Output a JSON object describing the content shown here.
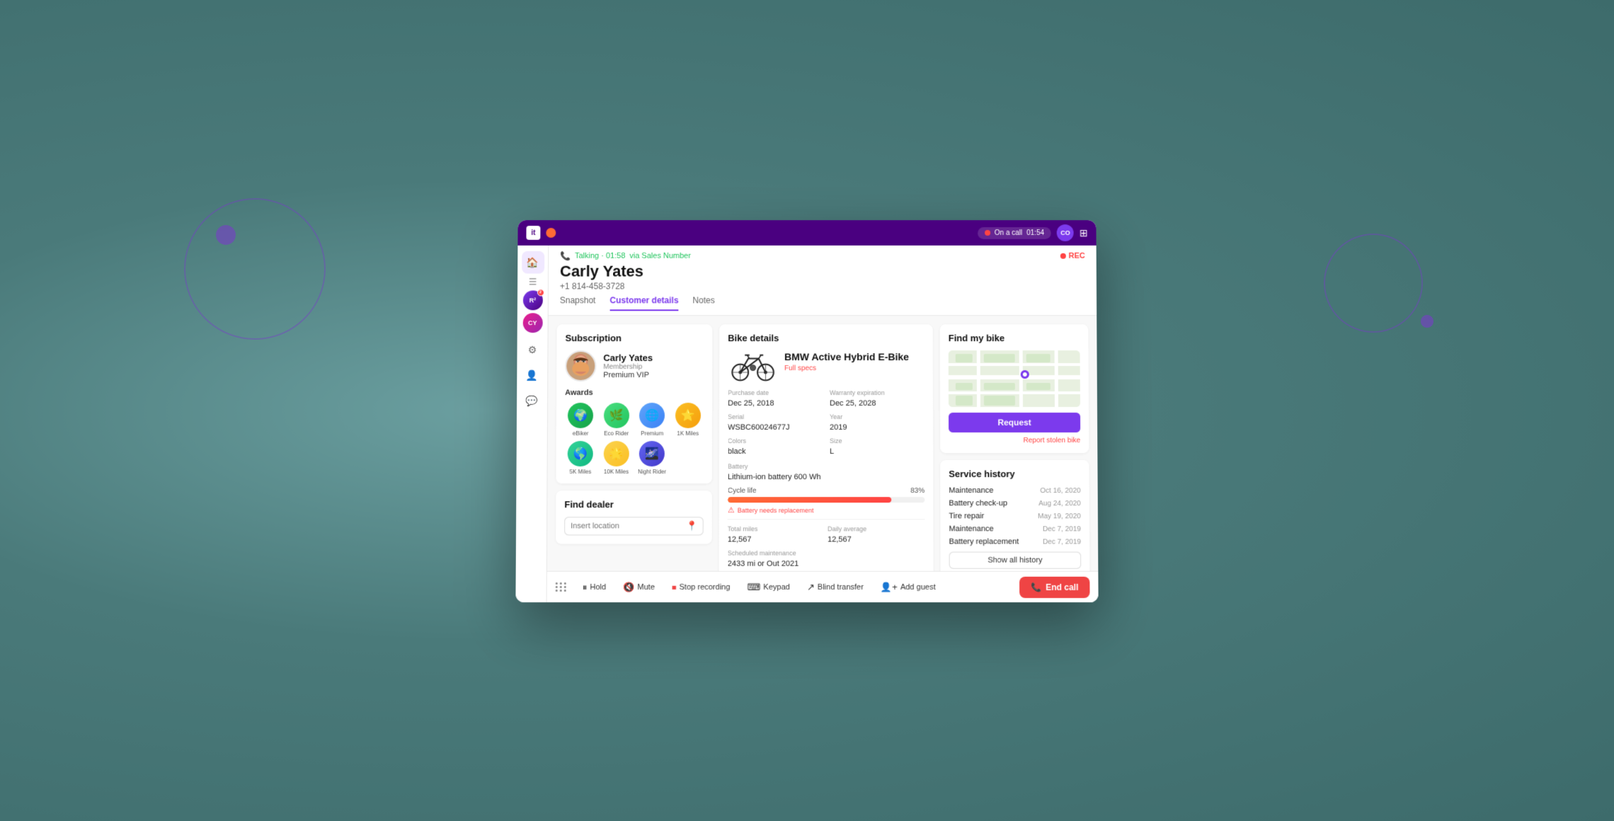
{
  "titleBar": {
    "logoText": "it",
    "callBadge": {
      "label": "On a call",
      "time": "01:54"
    },
    "avatarInitials": "CO"
  },
  "callHeader": {
    "talkingLabel": "Talking · 01:58",
    "viaSalesNumber": "via Sales Number",
    "recLabel": "REC",
    "customerName": "Carly Yates",
    "customerPhone": "+1 814-458-3728"
  },
  "tabs": {
    "snapshot": "Snapshot",
    "customerDetails": "Customer details",
    "notes": "Notes"
  },
  "subscription": {
    "title": "Subscription",
    "customerName": "Carly Yates",
    "membershipLabel": "Membership",
    "tierLabel": "Premium VIP"
  },
  "awards": {
    "title": "Awards",
    "items": [
      {
        "label": "eBiker",
        "emoji": "🌍"
      },
      {
        "label": "Eco Rider",
        "emoji": "🌿"
      },
      {
        "label": "Premium",
        "emoji": "🌐"
      },
      {
        "label": "1K Miles",
        "emoji": "🌟"
      },
      {
        "label": "5K Miles",
        "emoji": "🌎"
      },
      {
        "label": "10K Miles",
        "emoji": "⭐"
      },
      {
        "label": "Night Rider",
        "emoji": "🌌"
      }
    ]
  },
  "findDealer": {
    "title": "Find dealer",
    "inputPlaceholder": "Insert location"
  },
  "bikeDetails": {
    "title": "Bike details",
    "bikeName": "BMW Active Hybrid E-Bike",
    "fullSpecsLabel": "Full specs",
    "purchaseDate": {
      "label": "Purchase date",
      "value": "Dec 25, 2018"
    },
    "warrantyExpiration": {
      "label": "Warranty expiration",
      "value": "Dec 25, 2028"
    },
    "serial": {
      "label": "Serial",
      "value": "WSBC60024677J"
    },
    "year": {
      "label": "Year",
      "value": "2019"
    },
    "colors": {
      "label": "Colors",
      "value": "black"
    },
    "size": {
      "label": "Size",
      "value": "L"
    },
    "battery": {
      "label": "Battery",
      "value": "Lithium-ion battery 600 Wh"
    },
    "cycleLife": {
      "label": "Cycle life",
      "percentage": 83
    },
    "batteryWarning": "Battery needs replacement",
    "totalMiles": {
      "label": "Total miles",
      "value": "12,567"
    },
    "dailyAverage": {
      "label": "Daily average",
      "value": "12,567"
    },
    "scheduledMaintenance": {
      "label": "Scheduled maintenance",
      "value": "2433 mi or Out 2021"
    }
  },
  "findMyBike": {
    "title": "Find my bike",
    "requestBtnLabel": "Request",
    "reportStolenLabel": "Report stolen bike"
  },
  "serviceHistory": {
    "title": "Service history",
    "items": [
      {
        "name": "Maintenance",
        "date": "Oct 16, 2020"
      },
      {
        "name": "Battery check-up",
        "date": "Aug 24, 2020"
      },
      {
        "name": "Tire repair",
        "date": "May 19, 2020"
      },
      {
        "name": "Maintenance",
        "date": "Dec 7, 2019"
      },
      {
        "name": "Battery replacement",
        "date": "Dec 7, 2019"
      }
    ],
    "showAllLabel": "Show all history"
  },
  "toolbar": {
    "holdLabel": "Hold",
    "muteLabel": "Mute",
    "stopRecordingLabel": "Stop recording",
    "keypadLabel": "Keypad",
    "blindTransferLabel": "Blind transfer",
    "addGuestLabel": "Add guest",
    "endCallLabel": "End call"
  }
}
